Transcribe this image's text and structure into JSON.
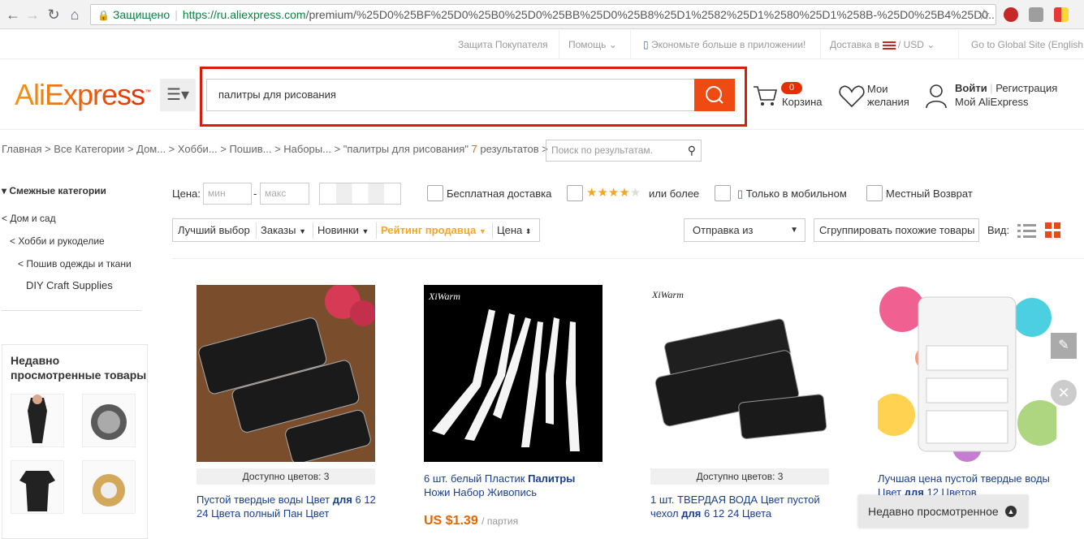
{
  "browser": {
    "secure_label": "Защищено",
    "url_host": "https://ru.aliexpress.com",
    "url_path": "/premium/%25D0%25BF%25D0%25B0%25D0%25BB%25D0%25B8%25D1%2582%25D1%2580%25D1%258B-%25D0%25B4%25D0..."
  },
  "topbar": {
    "buyer_protection": "Защита Покупателя",
    "help": "Помощь",
    "app_promo": "Экономьте больше в приложении!",
    "delivery": "Доставка в",
    "currency": "USD",
    "global": "Go to Global Site (English"
  },
  "header": {
    "logo": "AliExpress",
    "search_value": "палитры для рисования",
    "cart_count": "0",
    "cart_label": "Корзина",
    "wishlist_line1": "Мои",
    "wishlist_line2": "желания",
    "login": "Войти",
    "register": "Регистрация",
    "my_ali": "Мой AliExpress"
  },
  "breadcrumb": {
    "path": "Главная > Все Категории > Дом... > Хобби... > Пошив... > Наборы... > \"палитры для рисования\" ",
    "count": "7",
    "suffix": " результатов >",
    "refine_placeholder": "Поиск по результатам."
  },
  "sidebar": {
    "title": "Смежные категории",
    "links": [
      "< Дом и сад",
      "< Хобби и рукоделие",
      "< Пошив одежды и ткани",
      "DIY Craft Supplies"
    ],
    "recent_title_1": "Недавно",
    "recent_title_2": "просмотренные товары"
  },
  "filters": {
    "price_label": "Цена:",
    "min_placeholder": "мин",
    "max_placeholder": "макс",
    "free_shipping": "Бесплатная доставка",
    "rating_suffix": "или более",
    "mobile_only": "Только в мобильном",
    "local_return": "Местный Возврат",
    "rating_stars": 4
  },
  "sort": {
    "best": "Лучший выбор",
    "orders": "Заказы",
    "new": "Новинки",
    "seller_rating": "Рейтинг продавца",
    "price": "Цена",
    "ship_from": "Отправка из",
    "group_similar": "Сгруппировать похожие товары",
    "view_label": "Вид:"
  },
  "products": [
    {
      "colors": "Доступно цветов: 3",
      "title_a": "Пустой твердые воды Цвет ",
      "title_b": "для",
      "title_c": " 6 12 24 Цвета полный Пан Цвет"
    },
    {
      "brand": "XiWarm",
      "title_a": "6 шт. белый Пластик ",
      "title_b": "Палитры",
      "title_c": " Ножи Набор Живопись",
      "price": "US $1.39",
      "unit": "/ партия"
    },
    {
      "brand": "XiWarm",
      "colors": "Доступно цветов: 3",
      "title_a": "1 шт. ТВЕРДАЯ ВОДА Цвет пустой чехол ",
      "title_b": "для",
      "title_c": " 6 12 24 Цвета"
    },
    {
      "title_a": "Лучшая цена пустой твердые воды Цвет ",
      "title_b": "для",
      "title_c": " 12 Цветов"
    }
  ],
  "recent_bar": "Недавно просмотренное",
  "colors": {
    "accent": "#e62e04",
    "search_btn": "#f04a13",
    "price": "#e56600",
    "link": "#1a3e91"
  }
}
